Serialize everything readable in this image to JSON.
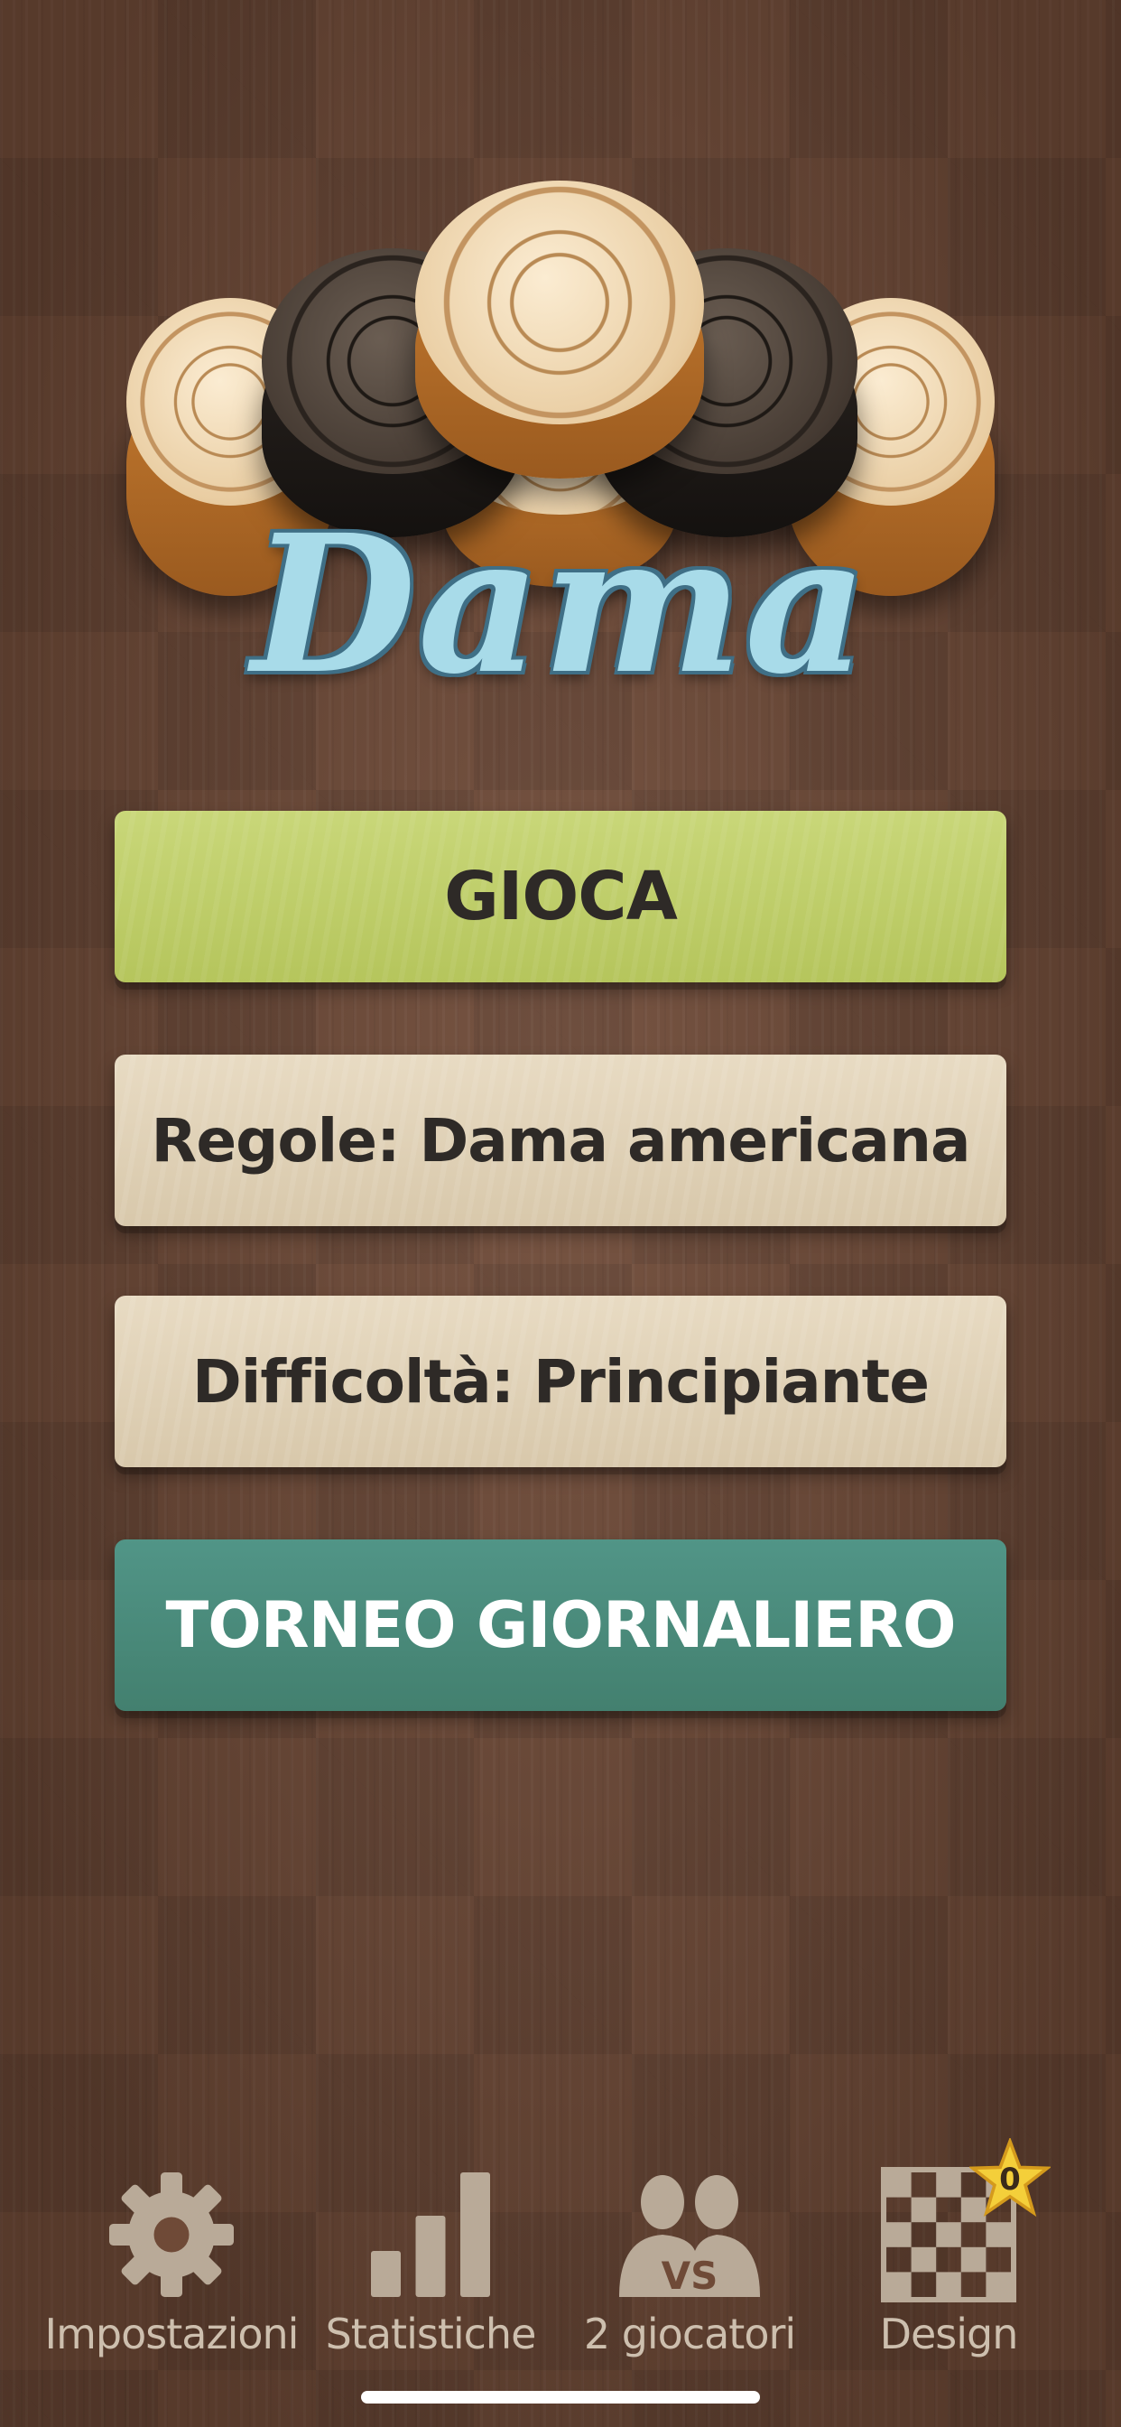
{
  "app": {
    "logo_text": "Dama"
  },
  "menu": {
    "play_label": "GIOCA",
    "rules_label": "Regole: Dama americana",
    "difficulty_label": "Difficoltà: Principiante",
    "tournament_label": "TORNEO GIORNALIERO"
  },
  "tabbar": {
    "items": [
      {
        "label": "Impostazioni",
        "icon": "gear-icon"
      },
      {
        "label": "Statistiche",
        "icon": "bar-chart-icon"
      },
      {
        "label": "2 giocatori",
        "icon": "two-players-vs-icon"
      },
      {
        "label": "Design",
        "icon": "checkerboard-icon"
      }
    ],
    "design_badge_count": "0",
    "vs_text": "VS"
  },
  "colors": {
    "play_button": "#bccb66",
    "option_button": "#e0d2b8",
    "tournament_button": "#4a8a7b",
    "logo": "#a8dbe9",
    "tab_icon": "#b9aa98"
  }
}
